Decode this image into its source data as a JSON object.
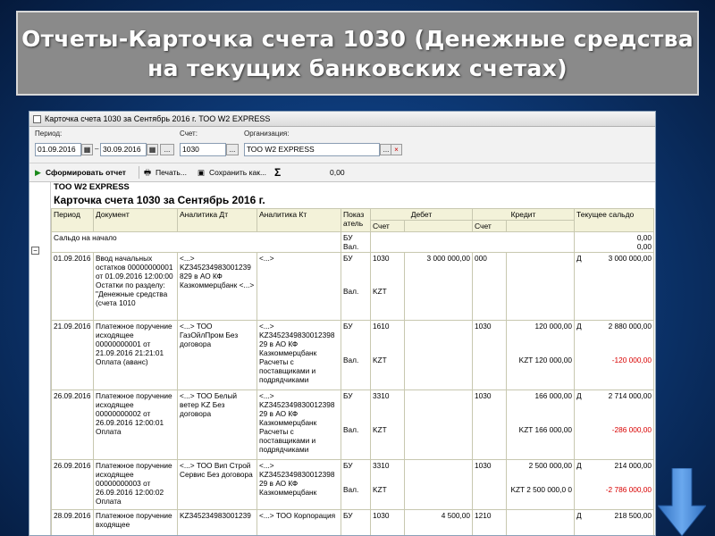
{
  "slide_title": "Отчеты-Карточка счета 1030 (Денежные средства на текущих банковских счетах)",
  "window": {
    "title": "Карточка счета 1030 за Сентябрь 2016 г. ТОО W2 EXPRESS"
  },
  "params": {
    "period_label": "Период:",
    "date_from": "01.09.2016",
    "date_to": "30.09.2016",
    "more_btn": "...",
    "account_label": "Счет:",
    "account_value": "1030",
    "org_label": "Организация:",
    "org_value": "ТОО W2 EXPRESS",
    "clear_btn": "×",
    "date_sep": "–"
  },
  "toolbar": {
    "generate": "Сформировать отчет",
    "print": "Печать...",
    "save": "Сохранить как...",
    "sum_sign": "Σ",
    "sum_value": "0,00"
  },
  "report": {
    "org": "ТОО W2 EXPRESS",
    "title": "Карточка счета 1030 за Сентябрь 2016 г.",
    "headers": {
      "period": "Период",
      "document": "Документ",
      "an_dt": "Аналитика Дт",
      "an_kt": "Аналитика Кт",
      "indicator": "Показ атель",
      "debit": "Дебет",
      "credit": "Кредит",
      "balance": "Текущее сальдо",
      "account": "Счет"
    },
    "opening": {
      "label": "Сальдо на начало",
      "ind1": "БУ",
      "ind2": "Вал.",
      "val1": "0,00",
      "val2": "0,00"
    },
    "rows": [
      {
        "period": "01.09.2016",
        "document": "Ввод начальных остатков 00000000001 от 01.09.2016 12:00:00 Остатки по разделу: \"Денежные средства (счета 1010",
        "an_dt": "<...> KZ345234983001239 829 в АО КФ Казкоммерцбанк <...>",
        "an_kt": "<...>",
        "ind1": "БУ",
        "ind2": "Вал.",
        "dt_acc": "1030",
        "dt_sum": "3 000 000,00",
        "dt_cur": "KZT",
        "kt_acc": "000",
        "kt_sum": "",
        "kt_cur": "",
        "bal_side": "Д",
        "bal": "3 000 000,00",
        "bal_cur": ""
      },
      {
        "period": "21.09.2016",
        "document": "Платежное поручение исходящее 00000000001 от 21.09.2016 21:21:01 Оплата (аванс)",
        "an_dt": "<...> ТОО ГазОйлПром Без договора",
        "an_kt": "<...> KZ3452349830012398 29 в АО КФ Казкоммерцбанк Расчеты с поставщиками и подрядчиками",
        "ind1": "БУ",
        "ind2": "Вал.",
        "dt_acc": "1610",
        "dt_sum": "",
        "dt_cur": "KZT",
        "kt_acc": "1030",
        "kt_sum": "120 000,00",
        "kt_cur": "KZT 120 000,00",
        "bal_side": "Д",
        "bal": "2 880 000,00",
        "bal_cur": "-120 000,00"
      },
      {
        "period": "26.09.2016",
        "document": "Платежное поручение исходящее 00000000002 от 26.09.2016 12:00:01 Оплата",
        "an_dt": "<...> ТОО Белый ветер KZ Без договора",
        "an_kt": "<...> KZ3452349830012398 29 в АО КФ Казкоммерцбанк Расчеты с поставщиками и подрядчиками",
        "ind1": "БУ",
        "ind2": "Вал.",
        "dt_acc": "3310",
        "dt_sum": "",
        "dt_cur": "KZT",
        "kt_acc": "1030",
        "kt_sum": "166 000,00",
        "kt_cur": "KZT 166 000,00",
        "bal_side": "Д",
        "bal": "2 714 000,00",
        "bal_cur": "-286 000,00"
      },
      {
        "period": "26.09.2016",
        "document": "Платежное поручение исходящее 00000000003 от 26.09.2016 12:00:02 Оплата",
        "an_dt": "<...> ТОО Вип Строй Сервис Без договора",
        "an_kt": "<...> KZ3452349830012398 29 в АО КФ Казкоммерцбанк",
        "ind1": "БУ",
        "ind2": "Вал.",
        "dt_acc": "3310",
        "dt_sum": "",
        "dt_cur": "KZT",
        "kt_acc": "1030",
        "kt_sum": "2 500 000,00",
        "kt_cur": "KZT 2 500 000,0 0",
        "bal_side": "Д",
        "bal": "214 000,00",
        "bal_cur": "-2 786 000,00"
      },
      {
        "period": "28.09.2016",
        "document": "Платежное поручение входящее",
        "an_dt": "KZ345234983001239",
        "an_kt": "<...> ТОО Корпорация",
        "ind1": "БУ",
        "ind2": "",
        "dt_acc": "1030",
        "dt_sum": "4 500,00",
        "dt_cur": "",
        "kt_acc": "1210",
        "kt_sum": "",
        "kt_cur": "",
        "bal_side": "Д",
        "bal": "218 500,00",
        "bal_cur": ""
      }
    ]
  },
  "colors": {
    "accent_red": "#d80000",
    "header_bg": "#f3f2d9",
    "title_box": "#8a8a8a",
    "arrow": "#4a90e2"
  },
  "icons": [
    "calendar-icon",
    "play-icon",
    "printer-icon",
    "save-icon",
    "sum-icon",
    "arrow-down-icon"
  ]
}
